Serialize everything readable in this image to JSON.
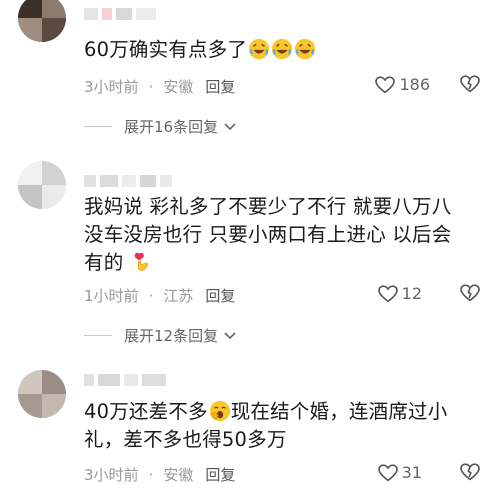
{
  "comments": [
    {
      "text": "60万确实有点多了",
      "emojis": [
        "laugh-cry-emoji",
        "laugh-cry-emoji",
        "laugh-cry-emoji"
      ],
      "time": "3小时前",
      "location": "安徽",
      "reply_label": "回复",
      "likes": "186",
      "expand_label": "展开16条回复"
    },
    {
      "text_lines": [
        "我妈说 彩礼多了不要少了不行 就要八万八",
        "没车没房也行 只要小两口有上进心 以后会",
        "有的"
      ],
      "emojis": [
        "heart-finger-emoji"
      ],
      "time": "1小时前",
      "location": "江苏",
      "reply_label": "回复",
      "likes": "12",
      "expand_label": "展开12条回复"
    },
    {
      "text_lines": [
        "40万还差不多",
        "现在结个婚，连酒席过小",
        "礼，差不多也得50多万"
      ],
      "emojis": [
        "yawn-emoji"
      ],
      "time": "3小时前",
      "location": "安徽",
      "reply_label": "回复",
      "likes": "31"
    }
  ]
}
